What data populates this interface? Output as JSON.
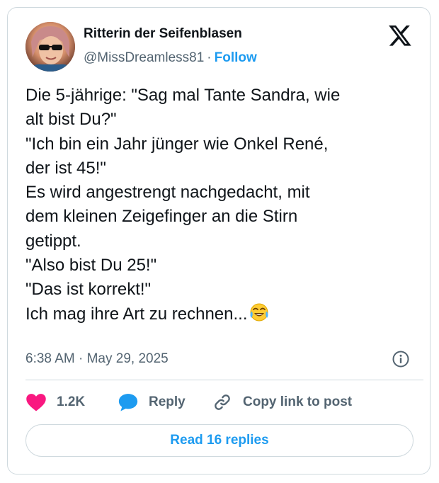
{
  "author": {
    "name": "Ritterin der Seifenblasen",
    "handle": "@MissDreamless81",
    "separator": "·",
    "follow_label": "Follow"
  },
  "tweet": {
    "lines": [
      "Die 5-jährige: \"Sag mal Tante Sandra, wie",
      "alt bist Du?\"",
      "\"Ich bin ein Jahr jünger wie Onkel René,",
      "der ist 45!\"",
      "Es wird angestrengt nachgedacht, mit",
      "dem kleinen Zeigefinger an die Stirn",
      "getippt.",
      "\"Also bist Du 25!\"",
      "\"Das ist korrekt!\"",
      "Ich mag ihre Art zu rechnen..."
    ],
    "emoji": "face-with-tears-of-joy",
    "timestamp": "6:38 AM · May 29, 2025"
  },
  "actions": {
    "like_count": "1.2K",
    "reply_label": "Reply",
    "copy_link_label": "Copy link to post"
  },
  "read_replies_label": "Read 16 replies",
  "icons": {
    "x_logo": "x-logo-icon",
    "heart": "heart-icon",
    "reply": "speech-bubble-icon",
    "link": "link-icon",
    "info": "info-icon"
  },
  "colors": {
    "text": "#0f1419",
    "secondary": "#536471",
    "accent": "#1d9bf0",
    "like": "#f91880",
    "border": "#cfd9de"
  }
}
